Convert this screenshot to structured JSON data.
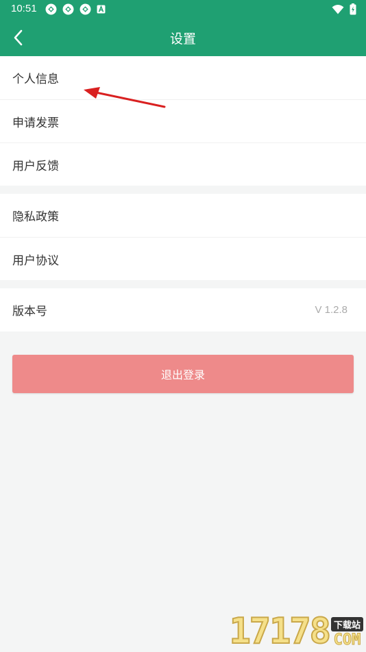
{
  "status_bar": {
    "time": "10:51",
    "left_icons": [
      "sync-icon",
      "sync-icon",
      "sync-icon",
      "a-badge-icon"
    ],
    "right_icons": [
      "wifi-icon",
      "battery-icon"
    ]
  },
  "header": {
    "title": "设置",
    "back_icon": "chevron-left-icon",
    "background_color": "#1fa072"
  },
  "groups": [
    {
      "items": [
        {
          "label": "个人信息"
        },
        {
          "label": "申请发票"
        },
        {
          "label": "用户反馈"
        }
      ]
    },
    {
      "items": [
        {
          "label": "隐私政策"
        },
        {
          "label": "用户协议"
        }
      ]
    },
    {
      "items": [
        {
          "label": "版本号",
          "value": "V 1.2.8"
        }
      ]
    }
  ],
  "logout": {
    "label": "退出登录",
    "color": "#ee8a8a"
  },
  "annotation": {
    "arrow_color": "#d92020"
  },
  "watermark": {
    "number": "17178",
    "tag": "下载站",
    "suffix": "COM"
  }
}
